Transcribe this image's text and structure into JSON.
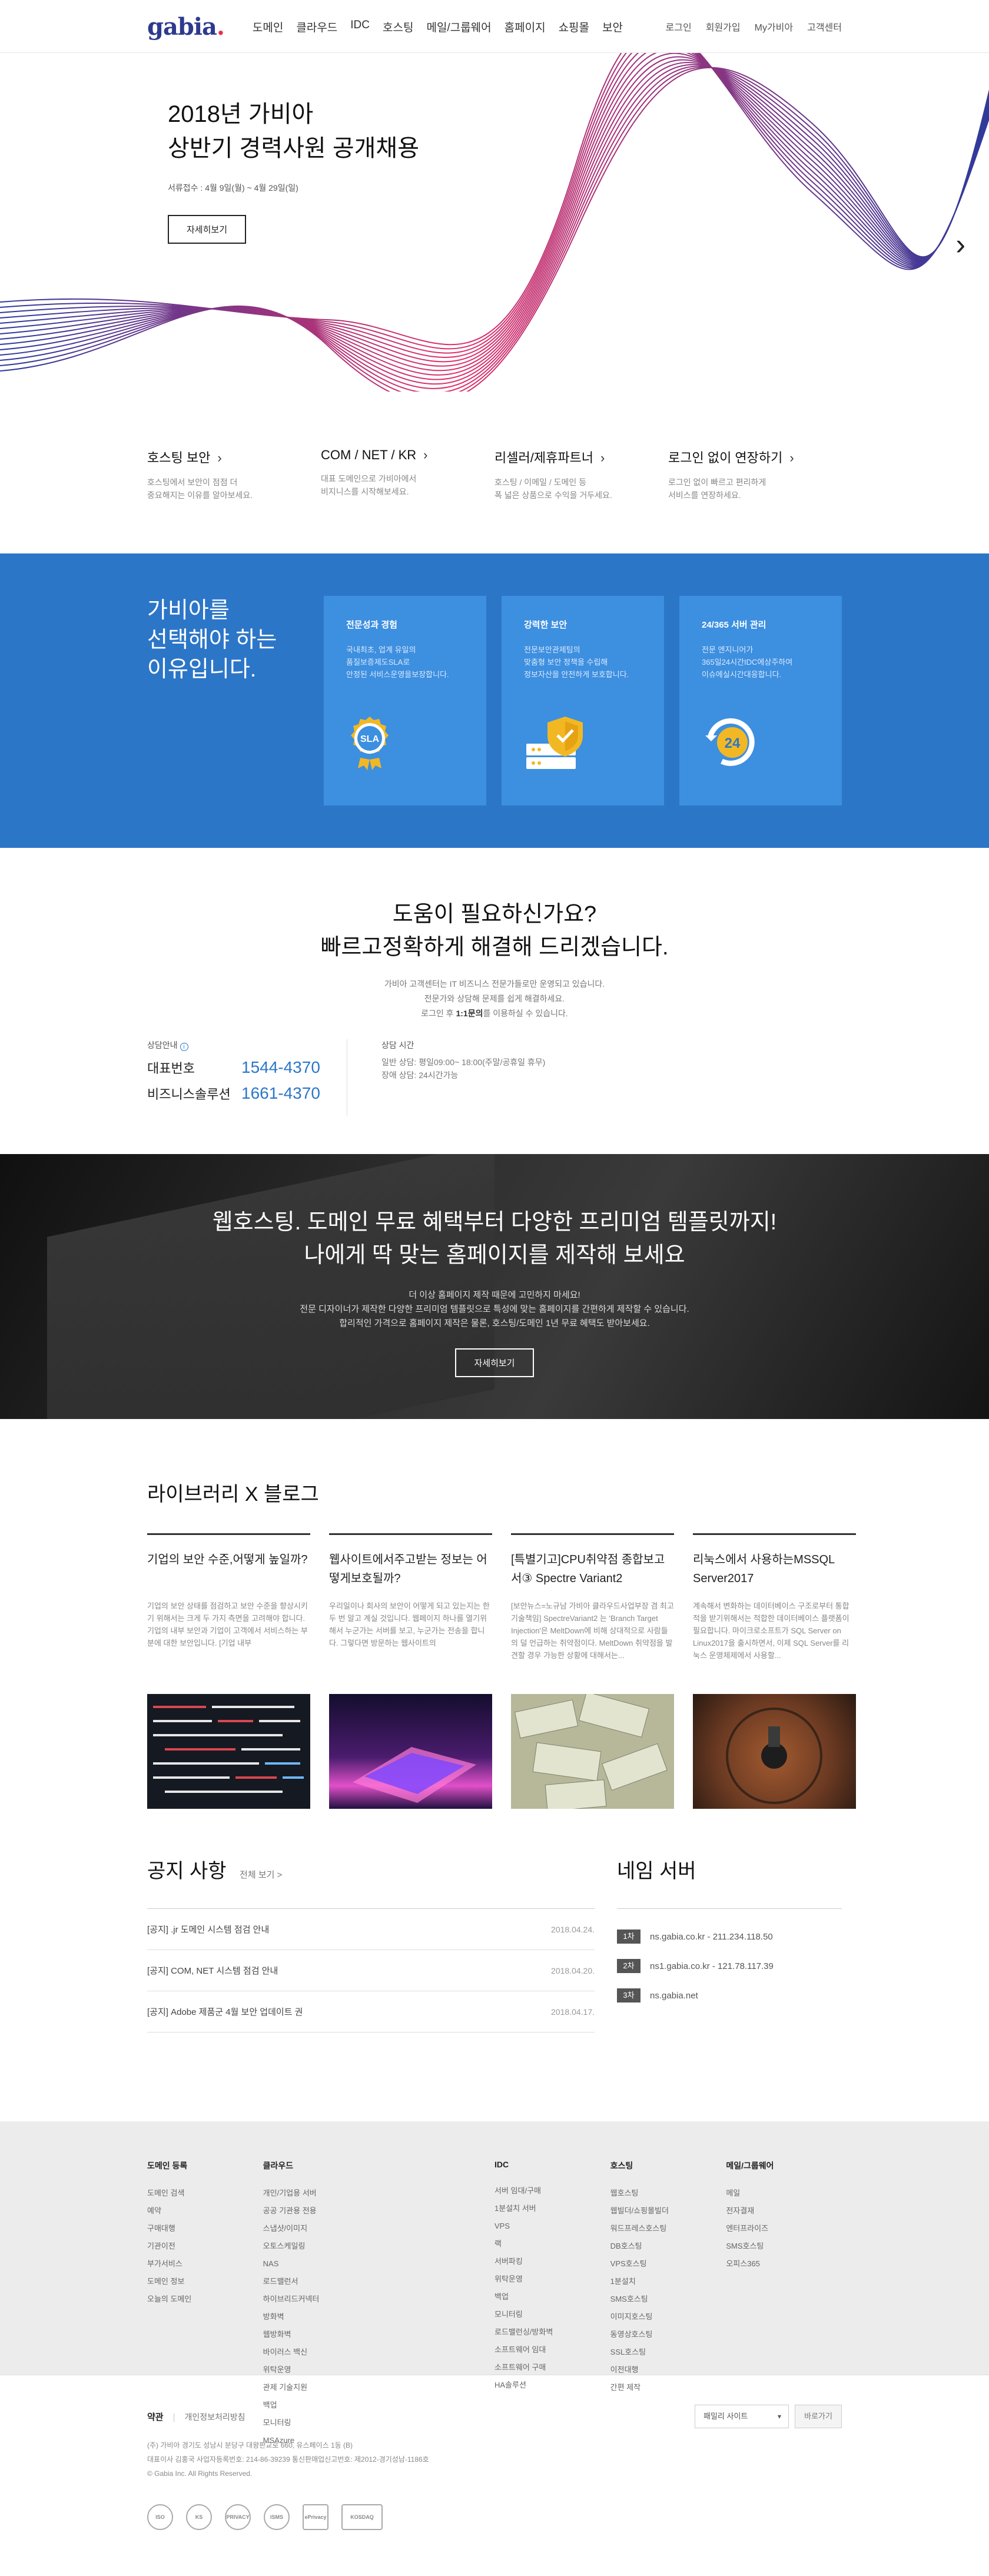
{
  "header": {
    "logo": "gabia",
    "logo_dot": ".",
    "nav": [
      "도메인",
      "클라우드",
      "IDC",
      "호스팅",
      "메일/그룹웨어",
      "홈페이지",
      "쇼핑몰",
      "보안"
    ],
    "util": [
      "로그인",
      "회원가입",
      "My가비아",
      "고객센터"
    ]
  },
  "hero": {
    "title_line1": "2018년 가비아",
    "title_line2": "상반기 경력사원 공개채용",
    "period": "서류접수 : 4월 9일(월) ~ 4월 29일(일)",
    "button": "자세히보기",
    "colors": {
      "wave_start": "#2a3a9c",
      "wave_end": "#e0306a"
    }
  },
  "quick": [
    {
      "title": "호스팅 보안",
      "desc1": "호스팅에서 보안이 점점 더",
      "desc2": "중요해지는 이유를 알아보세요."
    },
    {
      "title": "COM / NET / KR",
      "desc1": "대표 도메인으로 가비아에서",
      "desc2": "비지니스를 시작해보세요."
    },
    {
      "title": "리셀러/제휴파트너",
      "desc1": "호스팅 / 이메일 / 도메인 등",
      "desc2": "폭 넓은 상품으로 수익을 거두세요."
    },
    {
      "title": "로그인 없이 연장하기",
      "desc1": "로그인 없이 빠르고 편리하게",
      "desc2": "서비스를 연장하세요."
    }
  ],
  "why": {
    "title_line1": "가비아를",
    "title_line2": "선택해야 하는",
    "title_line3": "이유입니다.",
    "cards": [
      {
        "title": "전문성과 경험",
        "l1": "국내최초, 업계 유일의",
        "l2": "품질보증제도SLA로",
        "l3": "안정된 서비스운영을보장합니다.",
        "icon": "sla-badge-icon"
      },
      {
        "title": "강력한 보안",
        "l1": "전문보안관제팀의",
        "l2": "맞춤형 보안 정책을 수립해",
        "l3": "정보자산을 안전하게 보호합니다.",
        "icon": "shield-server-icon"
      },
      {
        "title": "24/365 서버 관리",
        "l1": "전문 엔지니어가",
        "l2": "365일24시간IDC에상주하여",
        "l3": "이슈에실시간대응합니다.",
        "icon": "24-support-icon"
      }
    ],
    "colors": {
      "bg": "#2c76c8",
      "card": "#3d8fe0",
      "accent": "#f2b824"
    }
  },
  "help": {
    "title_line1": "도움이 필요하신가요?",
    "title_line2": "빠르고정확하게 해결해 드리겠습니다.",
    "desc1": "가비아 고객센터는 IT 비즈니스 전문가들로만 운영되고 있습니다.",
    "desc2": "전문가와 상담해 문제를 쉽게 해결하세요.",
    "desc3_pre": "로그인 후",
    "desc3_bold": "1:1문의",
    "desc3_post": "를 이용하실 수 있습니다.",
    "phone_label": "상담안내",
    "phones": [
      {
        "name": "대표번호",
        "number": "1544-4370"
      },
      {
        "name": "비즈니스솔루션",
        "number": "1661-4370"
      }
    ],
    "hours_label": "상담 시간",
    "hours1": "일반 상담: 평일09:00~ 18:00(주말/공휴일 휴무)",
    "hours2": "장애 상담: 24시간가능"
  },
  "banner": {
    "title_line1": "웹호스팅. 도메인 무료 혜택부터 다양한 프리미엄 템플릿까지!",
    "title_line2": "나에게 딱 맞는 홈페이지를 제작해 보세요",
    "desc1": "더 이상 홈페이지 제작 때문에 고민하지 마세요!",
    "desc2": "전문 디자이너가 제작한 다양한 프리미엄 템플릿으로 특성에 맞는 홈페이지를 간편하게 제작할 수 있습니다.",
    "desc3": "합리적인 가격으로 홈페이지 제작은 물론, 호스팅/도메인 1년 무료 혜택도 받아보세요.",
    "button": "자세히보기"
  },
  "library": {
    "title": "라이브러리 X 블로그",
    "posts": [
      {
        "title": "기업의 보안 수준,어떻게 높일까?",
        "body": "기업의 보안 상태를 점검하고 보안 수준을 향상시키기 위해서는 크게 두 가지 측면을 고려해야 합니다. 기업의 내부 보안과 기업이 고객에서 서비스하는 부분에 대한 보안입니다. [기업 내부"
      },
      {
        "title": "웹사이트에서주고받는 정보는 어떻게보호될까?",
        "body": "우리일이나 회사의 보안이 어떻게 되고 있는지는 한두 번 알고 계실 것입니다. 웹페이지 하나를 열기위해서 누군가는 서버를 보고, 누군가는 전송을 합니다. 그렇다면 방문하는 웹사이트의"
      },
      {
        "title": "[특별기고]CPU취약점 종합보고서③ Spectre Variant2",
        "body": "[보안뉴스=노규남 가비아 클라우드사업부장 겸 최고기술책임] SpectreVariant2 는 'Branch Target Injection'은 MeltDown에 비해 상대적으로 사람들의 덜 언급하는 취약점이다. MeltDown 취약점을 발견할 경우 가능한 상황에 대해서는..."
      },
      {
        "title": "리눅스에서 사용하는MSSQL Server2017",
        "body": "계속해서 변화하는 데이터베이스 구조로부터 통합적을 받기위해서는 적합한 데이터베이스 플랫폼이 필요합니다. 마이크로소프트가 SQL Server on Linux2017을 출시하면서, 이제 SQL Server를 리눅스 운영체제에서 사용할..."
      }
    ]
  },
  "notice": {
    "title": "공지 사항",
    "more": "전체 보기 >",
    "items": [
      {
        "title": "[공지] .jr 도메인 시스템 점검 안내",
        "date": "2018.04.24."
      },
      {
        "title": "[공지] COM, NET 시스템 점검 안내",
        "date": "2018.04.20."
      },
      {
        "title": "[공지] Adobe 제품군 4월 보안 업데이트 권",
        "date": "2018.04.17."
      }
    ],
    "ns_title": "네임 서버",
    "ns": [
      {
        "num": "1차",
        "value": "ns.gabia.co.kr - 211.234.118.50"
      },
      {
        "num": "2차",
        "value": "ns1.gabia.co.kr - 121.78.117.39"
      },
      {
        "num": "3차",
        "value": "ns.gabia.net"
      }
    ]
  },
  "footer_links": {
    "domain": {
      "title": "도메인 등록",
      "items": [
        "도메인 검색",
        "예약",
        "구매대행",
        "기관이전",
        "부가서비스",
        "도메인 정보",
        "오늘의 도메인"
      ]
    },
    "cloud": {
      "title": "클라우드",
      "col1": [
        "개인/기업용 서버",
        "공공 기관용 전용",
        "스냅샷/이미지",
        "오토스케일링",
        "NAS",
        "로드밸런서",
        "하이브리드커넥터",
        "방화벽"
      ],
      "col2": [
        "웹방화벽",
        "바이러스 백신",
        "위탁운영",
        "관제 기술지원",
        "백업",
        "모니터링",
        "MSAzure"
      ]
    },
    "idc": {
      "title": "IDC",
      "items": [
        "서버 임대/구매",
        "1분설치 서버",
        "VPS",
        "랙",
        "서버파킹",
        "위탁운영",
        "백업",
        "모니터링",
        "로드밸런싱/방화벽",
        "소프트웨어 임대",
        "소프트웨어 구매",
        "HA솔루션"
      ]
    },
    "hosting": {
      "title": "호스팅",
      "items": [
        "웹호스팅",
        "웹빌더/쇼핑몰빌더",
        "워드프레스호스팅",
        "DB호스팅",
        "VPS호스팅",
        "1분설치",
        "SMS호스팅",
        "이미지호스팅",
        "동영상호스팅",
        "SSL호스팅",
        "이전대행",
        "간편 제작"
      ]
    },
    "mail": {
      "title": "메일/그룹웨어",
      "items": [
        "메일",
        "전자결재",
        "엔터프라이즈",
        "SMS호스팅",
        "오피스365"
      ]
    }
  },
  "footer_bottom": {
    "terms": "약관",
    "privacy": "개인정보처리방침",
    "addr1": "(주) 가비아    경기도 성남시 분당구 대왕판교로 660, 유스페이스 1동 (B)",
    "addr2": "대표이사 김홍국    사업자등록번호: 214-86-39239    통신판매업신고번호: 제2012-경기성남-1186호",
    "copyright": "© Gabia Inc. All Rights Reserved.",
    "family_site": "패밀리 사이트",
    "go": "바로가기",
    "certs": [
      "ISO",
      "KS",
      "PRIVACY",
      "ISMS",
      "ePrivacy",
      "KOSDAQ"
    ]
  }
}
